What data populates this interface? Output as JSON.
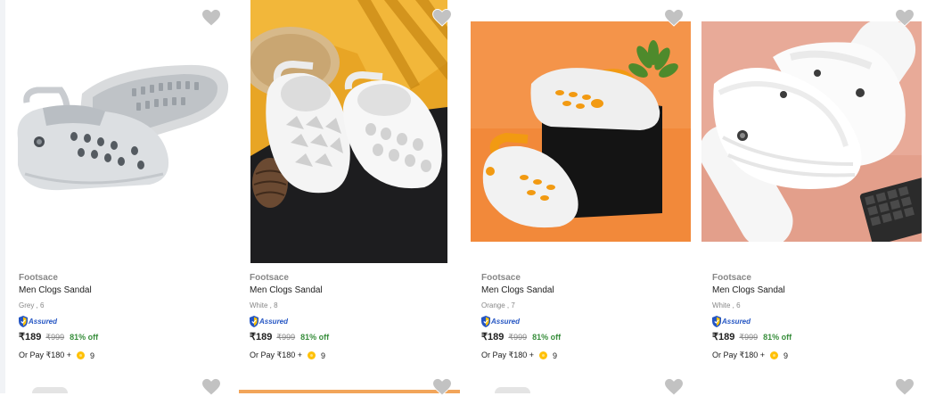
{
  "products": [
    {
      "brand": "Footsace",
      "name": "Men Clogs Sandal",
      "variant": "Grey , 6",
      "assured": "Assured",
      "price": "₹189",
      "mrp": "₹999",
      "discount": "81% off",
      "pay_prefix": "Or Pay ₹180 +",
      "coins": "9"
    },
    {
      "brand": "Footsace",
      "name": "Men Clogs Sandal",
      "variant": "White , 8",
      "assured": "Assured",
      "price": "₹189",
      "mrp": "₹999",
      "discount": "81% off",
      "pay_prefix": "Or Pay ₹180 +",
      "coins": "9"
    },
    {
      "brand": "Footsace",
      "name": "Men Clogs Sandal",
      "variant": "Orange , 7",
      "assured": "Assured",
      "price": "₹189",
      "mrp": "₹999",
      "discount": "81% off",
      "pay_prefix": "Or Pay ₹180 +",
      "coins": "9"
    },
    {
      "brand": "Footsace",
      "name": "Men Clogs Sandal",
      "variant": "White , 6",
      "assured": "Assured",
      "price": "₹189",
      "mrp": "₹999",
      "discount": "81% off",
      "pay_prefix": "Or Pay ₹180 +",
      "coins": "9"
    }
  ],
  "colors": {
    "mrp": "#878787",
    "discount": "#388e3c",
    "assured": "#2455c3",
    "heart": "#c2c2c2",
    "coin": "#ffc107"
  }
}
